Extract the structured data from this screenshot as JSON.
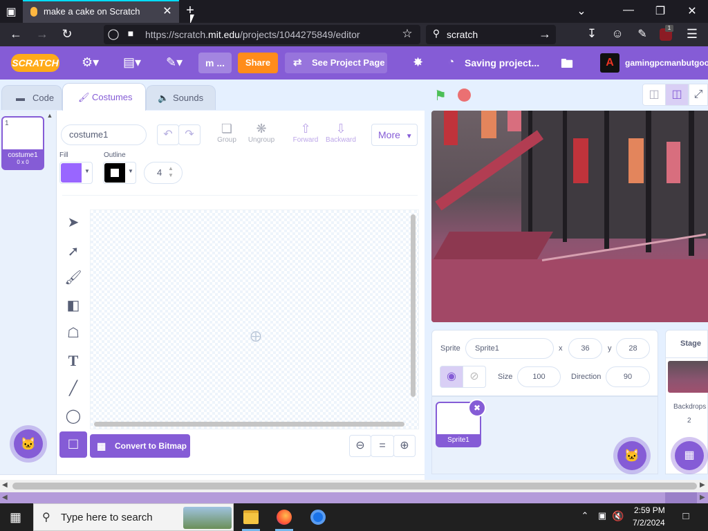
{
  "browser": {
    "tab_title": "make a cake on Scratch",
    "url_prefix": "https://scratch.",
    "url_domain": "mit.edu",
    "url_path": "/projects/1044275849/editor",
    "search_text": "scratch",
    "extension_badge": "1"
  },
  "menubar": {
    "logo": "SCRATCH",
    "project_title_short": "m ...",
    "share_label": "Share",
    "see_project_label": "See Project Page",
    "saving_label": "Saving project...",
    "username": "gamingpcmanbutgoo"
  },
  "tabs": {
    "code": "Code",
    "costumes": "Costumes",
    "sounds": "Sounds"
  },
  "costume_list": {
    "index": "1",
    "name": "costume1",
    "size": "0 x 0"
  },
  "paint": {
    "costume_name": "costume1",
    "group": "Group",
    "ungroup": "Ungroup",
    "forward": "Forward",
    "backward": "Backward",
    "more": "More",
    "fill_label": "Fill",
    "outline_label": "Outline",
    "outline_width": "4",
    "fill_color": "#9966ff",
    "convert_label": "Convert to Bitmap",
    "zoom_reset": "="
  },
  "sprite_info": {
    "sprite_label": "Sprite",
    "sprite_name": "Sprite1",
    "x_label": "x",
    "x_value": "36",
    "y_label": "y",
    "y_value": "28",
    "size_label": "Size",
    "size_value": "100",
    "direction_label": "Direction",
    "direction_value": "90",
    "thumb_name": "Sprite1"
  },
  "stage_panel": {
    "title": "Stage",
    "backdrops_label": "Backdrops",
    "backdrops_count": "2"
  },
  "taskbar": {
    "search_placeholder": "Type here to search",
    "time": "2:59 PM",
    "date": "7/2/2024"
  },
  "colors": {
    "scratch_purple": "#855cd6",
    "share_orange": "#ff8c1a",
    "go_green": "#4cbf56",
    "stop_red": "#ec5959"
  }
}
